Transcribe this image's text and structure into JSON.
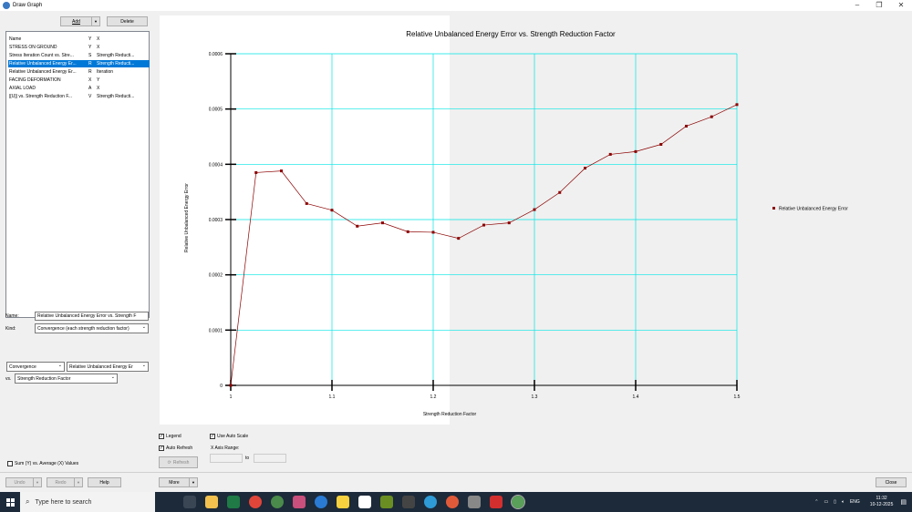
{
  "window": {
    "title": "Draw Graph"
  },
  "toolbar": {
    "add_label": "Add",
    "delete_label": "Delete"
  },
  "list": {
    "headers": [
      "Name",
      "Y",
      "X"
    ],
    "rows": [
      {
        "name": "STRESS ON GROUND",
        "y": "Y",
        "x": "X"
      },
      {
        "name": "Stress Iteration Count vs. Stre...",
        "y": "S",
        "x": "Strength Reducti..."
      },
      {
        "name": "Relative Unbalanced Energy Er...",
        "y": "R",
        "x": "Strength Reducti...",
        "selected": true
      },
      {
        "name": "Relative Unbalanced Energy Er...",
        "y": "R",
        "x": "Iteration"
      },
      {
        "name": "FACING DEFORMATION",
        "y": "X",
        "x": "Y"
      },
      {
        "name": "AXIAL LOAD",
        "y": "A",
        "x": "X"
      },
      {
        "name": "|[U]| vs. Strength Reduction F...",
        "y": "V",
        "x": "Strength Reducti..."
      }
    ]
  },
  "form": {
    "name_label": "Name:",
    "name_value": "Relative Unbalanced Energy Error vs. Strength F",
    "kind_label": "Kind:",
    "kind_value": "Convergence (each strength reduction factor)",
    "y_kind": "Convergence",
    "y_quantity": "Relative Unbalanced Energy Er",
    "vs_label": "vs.",
    "x_quantity": "Strength Reduction Factor",
    "sum_label": "Sum (Y) vs. Average (X) Values"
  },
  "options": {
    "legend_label": "Legend",
    "auto_refresh_label": "Auto Refresh",
    "refresh_label": "Refresh",
    "auto_scale_label": "Use Auto Scale",
    "x_range_label": "X Axis Range:",
    "to_label": "to"
  },
  "bottom": {
    "undo": "Undo",
    "redo": "Redo",
    "help": "Help",
    "more": "More",
    "close": "Close"
  },
  "taskbar": {
    "search_placeholder": "Type here to search",
    "time": "11:32",
    "date": "10-12-2025",
    "lang": "ENG"
  },
  "colors": {
    "grid": "#00e5e5",
    "series": "#8b0000",
    "selection": "#0078d7"
  },
  "chart_data": {
    "type": "line",
    "title": "Relative Unbalanced Energy Error vs. Strength Reduction Factor",
    "xlabel": "Strength Reduction Factor",
    "ylabel": "Relative Unbalanced Energy Error",
    "xlim": [
      1,
      1.5
    ],
    "ylim": [
      0,
      0.0006
    ],
    "x_ticks": [
      "1",
      "1.1",
      "1.2",
      "1.3",
      "1.4",
      "1.5"
    ],
    "y_ticks": [
      "0",
      "0.0001",
      "0.0002",
      "0.0003",
      "0.0004",
      "0.0005",
      "0.0006"
    ],
    "grid": true,
    "legend_position": "right",
    "series": [
      {
        "name": "Relative Unbalanced Energy Error",
        "x": [
          1.0,
          1.025,
          1.05,
          1.075,
          1.1,
          1.125,
          1.15,
          1.175,
          1.2,
          1.225,
          1.25,
          1.275,
          1.3,
          1.325,
          1.35,
          1.375,
          1.4,
          1.425,
          1.45,
          1.475,
          1.5
        ],
        "y": [
          0.0,
          0.000385,
          0.000388,
          0.000329,
          0.000317,
          0.000288,
          0.000294,
          0.000278,
          0.000277,
          0.000266,
          0.00029,
          0.000294,
          0.000318,
          0.000349,
          0.000393,
          0.000418,
          0.000423,
          0.000436,
          0.000469,
          0.000486,
          0.000508
        ]
      }
    ]
  }
}
